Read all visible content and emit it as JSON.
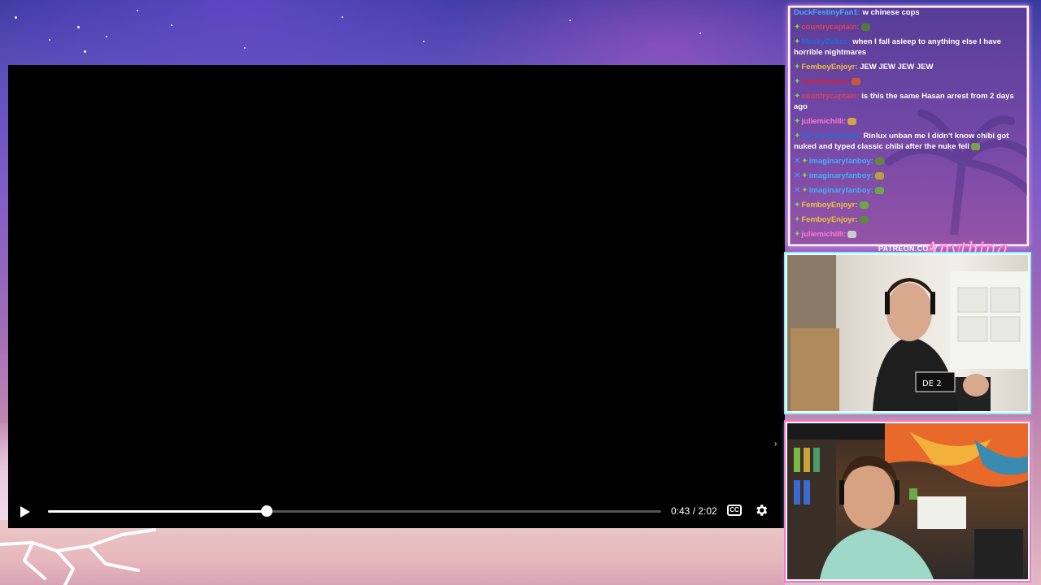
{
  "player": {
    "current_time": "0:43",
    "duration": "2:02",
    "time_text": "0:43 / 2:02",
    "progress": 0.357,
    "cc_label": "CC",
    "play_icon": "play-icon",
    "settings_icon": "gear-icon"
  },
  "chat": {
    "messages": [
      {
        "user": "DuckFestinyFan1:",
        "user_color": "#3fb0ff",
        "text": "w chinese cops",
        "badge": false,
        "sword": false,
        "emote": null
      },
      {
        "user": "countrycaptain:",
        "user_color": "#e0405a",
        "text": "",
        "badge": true,
        "sword": false,
        "emote": "#4a7c3a"
      },
      {
        "user": "MeekyBakes:",
        "user_color": "#1e6fd9",
        "text": "when I fall asleep to anything else I have horrible nightmares",
        "badge": true,
        "sword": false,
        "emote": null
      },
      {
        "user": "FemboyEnjoyr:",
        "user_color": "#f0c43a",
        "text": "JEW JEW JEW JEW",
        "badge": true,
        "sword": false,
        "emote": null
      },
      {
        "user": "JoshKannax:",
        "user_color": "#d0203a",
        "text": "",
        "badge": true,
        "sword": false,
        "emote": "#c9573a"
      },
      {
        "user": "countrycaptain:",
        "user_color": "#e0405a",
        "text": "is this the same Hasan arrest from 2 days ago",
        "badge": true,
        "sword": false,
        "emote": null
      },
      {
        "user": "juliemichilli:",
        "user_color": "#ff7ad1",
        "text": "",
        "badge": true,
        "sword": false,
        "emote": "#d8a24a"
      },
      {
        "user": "PersonManMan:",
        "user_color": "#1e6fd9",
        "text": "Rinlux unban me I didn't know chibi got nuked and typed classic chibi after the nuke fell",
        "badge": true,
        "sword": false,
        "emote": "#7aa14a"
      },
      {
        "user": "imaginaryfanboy:",
        "user_color": "#3fb0ff",
        "text": "",
        "badge": true,
        "sword": true,
        "emote": "#5c8a3a"
      },
      {
        "user": "imaginaryfanboy:",
        "user_color": "#3fb0ff",
        "text": "",
        "badge": true,
        "sword": true,
        "emote": "#b8a03a"
      },
      {
        "user": "imaginaryfanboy:",
        "user_color": "#3fb0ff",
        "text": "",
        "badge": true,
        "sword": true,
        "emote": "#6aa84a"
      },
      {
        "user": "FemboyEnjoyr:",
        "user_color": "#f0c43a",
        "text": "",
        "badge": true,
        "sword": false,
        "emote": "#6aa84a"
      },
      {
        "user": "FemboyEnjoyr:",
        "user_color": "#f0c43a",
        "text": "",
        "badge": true,
        "sword": false,
        "emote": "#5c8a3a"
      },
      {
        "user": "juliemichilli:",
        "user_color": "#ff7ad1",
        "text": "",
        "badge": true,
        "sword": false,
        "emote": "#cccccc"
      }
    ]
  },
  "overlay": {
    "patreon_text": "PATREON.COM/",
    "logo_text": "Anything Else",
    "shirt_text": "DE 2"
  },
  "colors": {
    "accent_pink": "#ff6ec7",
    "accent_cyan": "#7ff7f0"
  }
}
